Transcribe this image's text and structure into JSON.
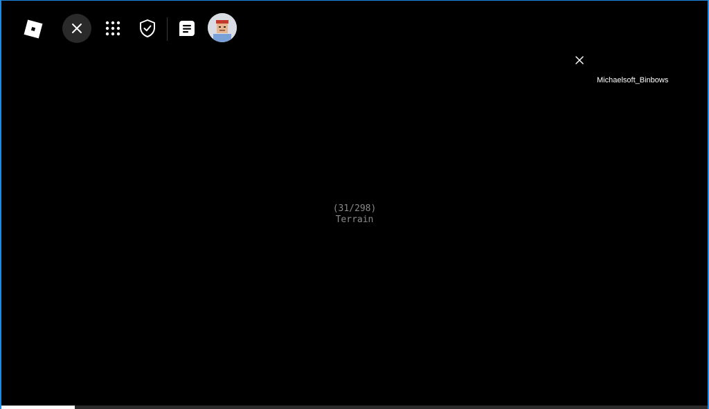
{
  "topbar": {
    "icons": [
      "roblox-logo-icon",
      "close-icon",
      "menu-grid-icon",
      "shield-check-icon",
      "chat-icon"
    ],
    "avatar_alt": "user-avatar"
  },
  "player_list": {
    "close_icon": "close-icon",
    "player_name": "Michaelsoft_Binbows"
  },
  "loading": {
    "count": "(31/298)",
    "label": "Terrain",
    "progress_fraction": 0.104
  },
  "colors": {
    "background": "#000000",
    "accent_border": "#1e88e5",
    "text_muted": "#8a8a8a",
    "progress_fill": "#ffffff",
    "progress_track": "#2b2b2b"
  }
}
